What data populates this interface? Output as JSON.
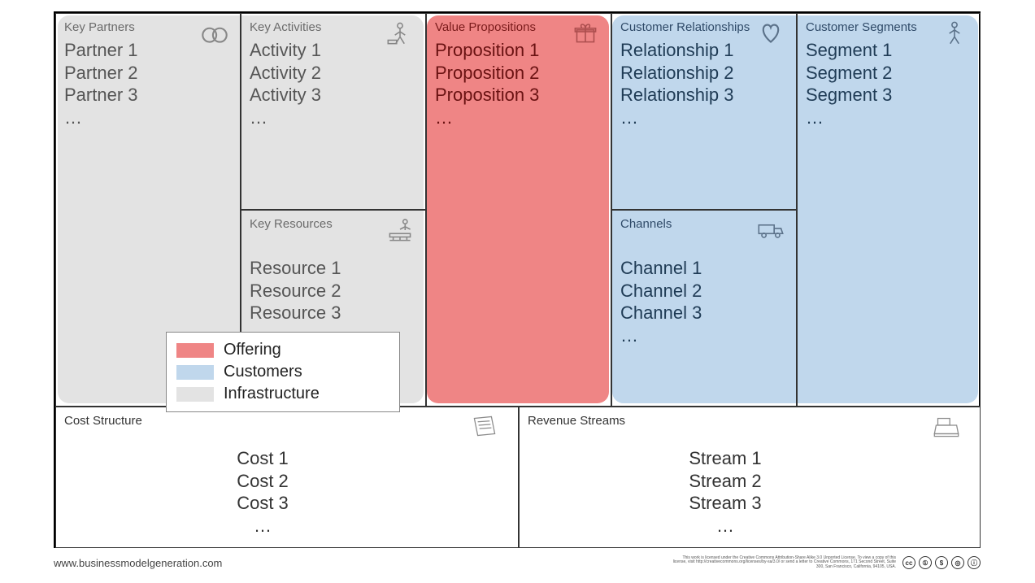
{
  "colors": {
    "offering": "#ef8585",
    "customers": "#c0d7ec",
    "infrastructure": "#e3e3e3",
    "finance": "#ffffff"
  },
  "blocks": {
    "partners": {
      "title": "Key Partners",
      "items": [
        "Partner 1",
        "Partner 2",
        "Partner 3",
        "…"
      ]
    },
    "activities": {
      "title": "Key Activities",
      "items": [
        "Activity 1",
        "Activity 2",
        "Activity 3",
        "…"
      ]
    },
    "resources": {
      "title": "Key Resources",
      "items": [
        "Resource 1",
        "Resource 2",
        "Resource 3"
      ]
    },
    "value": {
      "title": "Value Propositions",
      "items": [
        "Proposition 1",
        "Proposition 2",
        "Proposition 3",
        "…"
      ]
    },
    "relationships": {
      "title": "Customer Relationships",
      "items": [
        "Relationship 1",
        "Relationship 2",
        "Relationship 3",
        "…"
      ]
    },
    "channels": {
      "title": "Channels",
      "items": [
        "Channel 1",
        "Channel 2",
        "Channel 3",
        "…"
      ]
    },
    "segments": {
      "title": "Customer Segments",
      "items": [
        "Segment 1",
        "Segment 2",
        "Segment 3",
        "…"
      ]
    },
    "cost": {
      "title": "Cost Structure",
      "items": [
        "Cost 1",
        "Cost 2",
        "Cost 3",
        "…"
      ]
    },
    "revenue": {
      "title": "Revenue Streams",
      "items": [
        "Stream 1",
        "Stream 2",
        "Stream 3",
        "…"
      ]
    }
  },
  "legend": [
    {
      "label": "Offering",
      "color": "#ef8585"
    },
    {
      "label": "Customers",
      "color": "#c0d7ec"
    },
    {
      "label": "Infrastructure",
      "color": "#e3e3e3"
    }
  ],
  "footer": {
    "url": "www.businessmodelgeneration.com",
    "license_text": "This work is licensed under the Creative Commons Attribution-Share Alike 3.0 Unported License. To view a copy of this license, visit http://creativecommons.org/licenses/by-sa/3.0/ or send a letter to Creative Commons, 171 Second Street, Suite 300, San Francisco, California, 94105, USA.",
    "cc": [
      "cc",
      "①",
      "$",
      "◎",
      "ⓘ"
    ]
  }
}
